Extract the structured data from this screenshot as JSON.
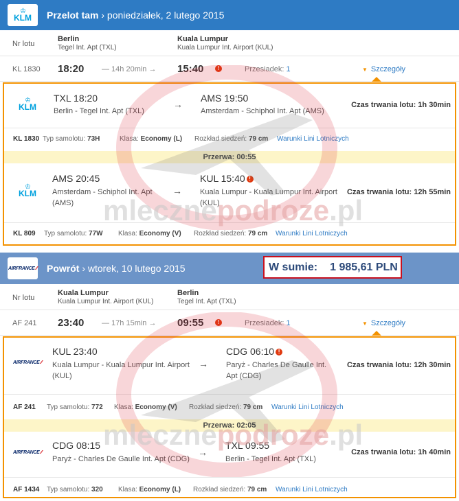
{
  "outbound": {
    "header": {
      "direction": "Przelot tam",
      "date": "› poniedziałek, 2 lutego 2015",
      "logo": "KLM"
    },
    "route": {
      "nr_label": "Nr lotu",
      "from_city": "Berlin",
      "from_airport": "Tegel Int. Apt (TXL)",
      "to_city": "Kuala Lumpur",
      "to_airport": "Kuala Lumpur Int. Airport (KUL)"
    },
    "summary": {
      "flight": "KL 1830",
      "dep_time": "18:20",
      "duration": "— 14h 20min →",
      "arr_time": "15:40",
      "stops_label": "Przesiadek:",
      "stops": "1",
      "details": "Szczegóły"
    },
    "segments": [
      {
        "logo": "KLM",
        "dep_time": "TXL 18:20",
        "dep_place": "Berlin - Tegel Int. Apt (TXL)",
        "arr_time": "AMS 19:50",
        "arr_place": "Amsterdam - Schiphol Int. Apt (AMS)",
        "duration": "Czas trwania lotu: 1h 30min",
        "flight": "KL 1830",
        "aircraft_label": "Typ samolotu:",
        "aircraft": "73H",
        "class_label": "Klasa:",
        "class": "Economy (L)",
        "seats_label": "Rozkład siedzeń:",
        "seats": "79 cm",
        "conditions": "Warunki Lini Lotniczych"
      },
      {
        "logo": "KLM",
        "dep_time": "AMS 20:45",
        "dep_place": "Amsterdam - Schiphol Int. Apt (AMS)",
        "arr_time": "KUL 15:40",
        "arr_place": "Kuala Lumpur - Kuala Lumpur Int. Airport (KUL)",
        "duration": "Czas trwania lotu: 12h 55min",
        "flight": "KL 809",
        "aircraft_label": "Typ samolotu:",
        "aircraft": "77W",
        "class_label": "Klasa:",
        "class": "Economy (V)",
        "seats_label": "Rozkład siedzeń:",
        "seats": "79 cm",
        "conditions": "Warunki Lini Lotniczych"
      }
    ],
    "layover": "Przerwa: 00:55"
  },
  "return": {
    "header": {
      "direction": "Powrót",
      "date": "› wtorek, 10 lutego 2015",
      "logo": "AIRFRANCE"
    },
    "total": {
      "label": "W sumie:",
      "amount": "1 985,61 PLN"
    },
    "route": {
      "nr_label": "Nr lotu",
      "from_city": "Kuala Lumpur",
      "from_airport": "Kuala Lumpur Int. Airport (KUL)",
      "to_city": "Berlin",
      "to_airport": "Tegel Int. Apt (TXL)"
    },
    "summary": {
      "flight": "AF 241",
      "dep_time": "23:40",
      "duration": "— 17h 15min →",
      "arr_time": "09:55",
      "stops_label": "Przesiadek:",
      "stops": "1",
      "details": "Szczegóły"
    },
    "segments": [
      {
        "logo": "AIRFRANCE",
        "dep_time": "KUL 23:40",
        "dep_place": "Kuala Lumpur - Kuala Lumpur Int. Airport (KUL)",
        "arr_time": "CDG 06:10",
        "arr_place": "Paryż - Charles De Gaulle Int. Apt (CDG)",
        "duration": "Czas trwania lotu: 12h 30min",
        "flight": "AF 241",
        "aircraft_label": "Typ samolotu:",
        "aircraft": "772",
        "class_label": "Klasa:",
        "class": "Economy (V)",
        "seats_label": "Rozkład siedzeń:",
        "seats": "79 cm",
        "conditions": "Warunki Lini Lotniczych"
      },
      {
        "logo": "AIRFRANCE",
        "dep_time": "CDG 08:15",
        "dep_place": "Paryż - Charles De Gaulle Int. Apt (CDG)",
        "arr_time": "TXL 09:55",
        "arr_place": "Berlin - Tegel Int. Apt (TXL)",
        "duration": "Czas trwania lotu: 1h 40min",
        "flight": "AF 1434",
        "aircraft_label": "Typ samolotu:",
        "aircraft": "320",
        "class_label": "Klasa:",
        "class": "Economy (L)",
        "seats_label": "Rozkład siedzeń:",
        "seats": "79 cm",
        "conditions": "Warunki Lini Lotniczych"
      }
    ],
    "layover": "Przerwa: 02:05"
  },
  "watermark": {
    "text_a": "mleczne",
    "text_b": "podroze",
    "text_c": ".pl"
  },
  "colors": {
    "header_out": "#2e7bc4",
    "header_ret": "#6c94c8",
    "accent": "#f39200",
    "warning": "#e03a10",
    "total_border": "#c8101e"
  }
}
